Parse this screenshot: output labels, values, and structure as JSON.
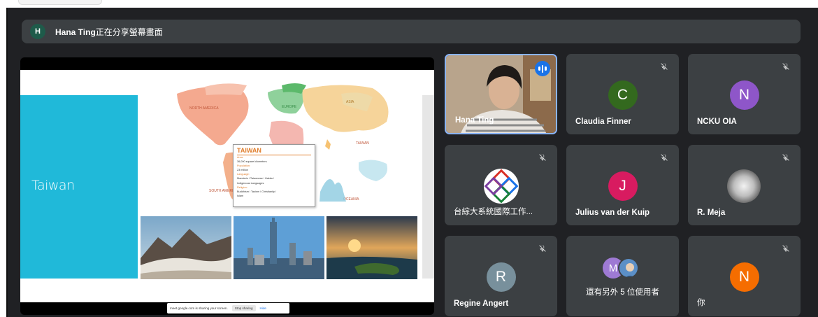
{
  "banner": {
    "avatar_letter": "H",
    "presenter": "Hana Ting",
    "message": "正在分享螢幕畫面"
  },
  "slide": {
    "title": "Taiwan",
    "map_labels": [
      "NORTH AMERICA",
      "EUROPE",
      "ASIA",
      "SOUTH AMERICA",
      "OCEANIA",
      "TAIWAN"
    ],
    "popup": {
      "heading": "TAIWAN",
      "lines": [
        {
          "text": "Area:",
          "key": true
        },
        {
          "text": "36,000 square kilometers",
          "key": false
        },
        {
          "text": "Population:",
          "key": true
        },
        {
          "text": "23 million",
          "key": false
        },
        {
          "text": "Language:",
          "key": true
        },
        {
          "text": "Mandarin / Taiwanese / Hakka /",
          "key": false
        },
        {
          "text": "Indigenous Languages",
          "key": false
        },
        {
          "text": "Religion:",
          "key": true
        },
        {
          "text": "Buddhism / Taoism / Christianity /",
          "key": false
        },
        {
          "text": "Islam",
          "key": false
        }
      ]
    }
  },
  "sharebar": {
    "text": "meet.google.com is sharing your screen.",
    "stop_label": "Stop sharing",
    "hide_label": "Hide"
  },
  "participants": [
    {
      "name": "Hana Ting",
      "type": "video",
      "speaking": true
    },
    {
      "name": "Claudia Finner",
      "letter": "C",
      "color": "#33691e",
      "muted": true
    },
    {
      "name": "NCKU OIA",
      "letter": "N",
      "color": "#8e56c9",
      "muted": true
    },
    {
      "name": "台綜大系統國際工作...",
      "type": "logo",
      "muted": true
    },
    {
      "name": "Julius van der Kuip",
      "letter": "J",
      "color": "#d81b60",
      "muted": true
    },
    {
      "name": "R. Meja",
      "type": "photo",
      "muted": true
    },
    {
      "name": "Regine Angert",
      "letter": "R",
      "color": "#78909c",
      "muted": true
    },
    {
      "name": "還有另外 5 位使用者",
      "type": "more",
      "letter": "M",
      "color": "#9e7ad4"
    },
    {
      "name": "你",
      "letter": "N",
      "color": "#f56d00",
      "muted": true
    }
  ],
  "colors": {
    "background": "#202124",
    "tile": "#3c4043",
    "accent": "#8ab4f8",
    "speaking": "#1a73e8",
    "slide_cyan": "#20b9d9"
  },
  "icons": {
    "muted": "mic-off-icon",
    "speaking": "audio-level-icon"
  }
}
